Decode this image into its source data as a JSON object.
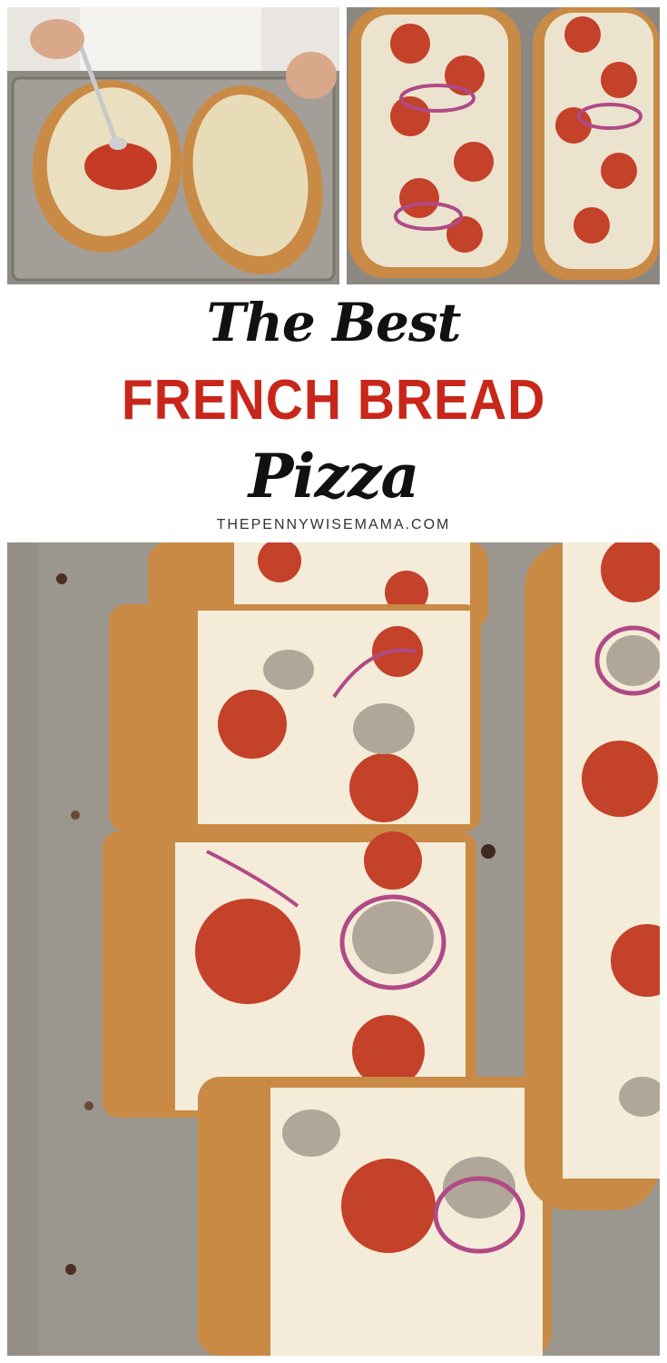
{
  "title": {
    "line1": "The Best",
    "line2": "FRENCH BREAD",
    "line3": "Pizza"
  },
  "website": "THEPENNYWISEMAMA.COM",
  "colors": {
    "title_dark": "#111111",
    "title_red": "#c9261b",
    "website": "#333333",
    "pan": "#8f8a82",
    "bread_crust": "#c98a45",
    "pepperoni": "#c4412a",
    "cheese": "#f4ecd8",
    "red_onion": "#b04a86"
  }
}
